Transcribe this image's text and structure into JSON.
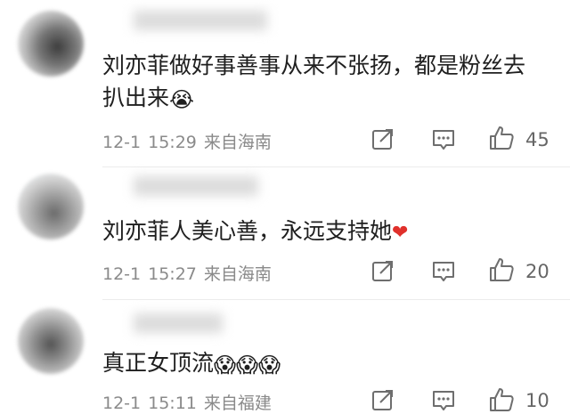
{
  "comments": [
    {
      "text": "刘亦菲做好事善事从来不张扬，都是粉丝去",
      "text2": "扒出来",
      "emoji": "😭",
      "date": "12-1",
      "time": "15:29",
      "source": "来自海南",
      "likes": "45"
    },
    {
      "text": "刘亦菲人美心善，永远支持她",
      "emoji": "❤",
      "date": "12-1",
      "time": "15:27",
      "source": "来自海南",
      "likes": "20"
    },
    {
      "text": "真正女顶流",
      "emoji": "😱😱😱",
      "date": "12-1",
      "time": "15:11",
      "source": "来自福建",
      "likes": "10"
    }
  ],
  "icons": {
    "share": "share-icon",
    "comment": "comment-icon",
    "like": "thumbs-up-icon"
  }
}
